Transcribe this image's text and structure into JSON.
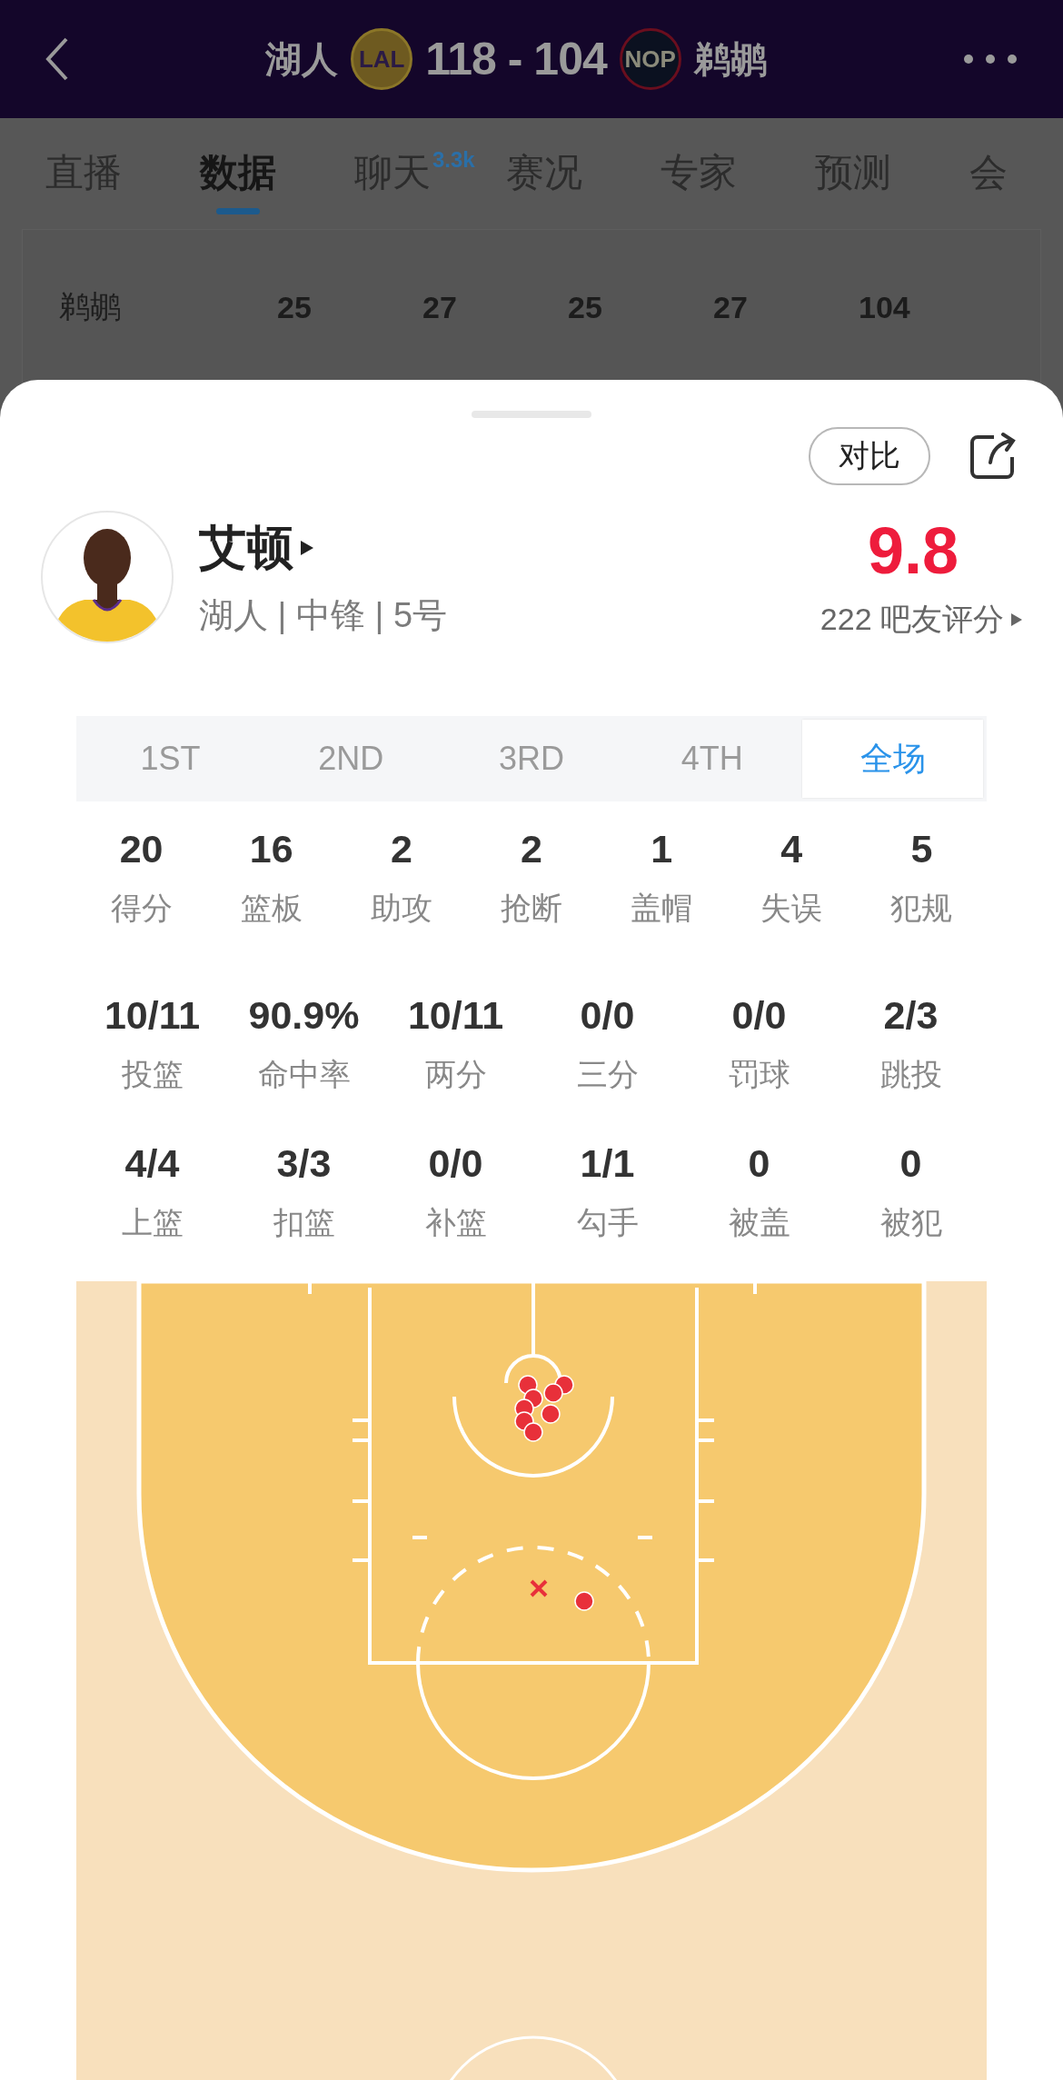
{
  "header": {
    "home_team": "湖人",
    "home_logo": "LAL",
    "score": "118 - 104",
    "away_logo": "NOP",
    "away_team": "鹈鹕"
  },
  "tabs": [
    {
      "label": "直播",
      "selected": false
    },
    {
      "label": "数据",
      "selected": true
    },
    {
      "label": "聊天",
      "selected": false,
      "badge": "3.3k"
    },
    {
      "label": "赛况",
      "selected": false
    },
    {
      "label": "专家",
      "selected": false
    },
    {
      "label": "预测",
      "selected": false
    },
    {
      "label": "会",
      "selected": false
    }
  ],
  "score_row": {
    "team": "鹈鹕",
    "values": [
      "25",
      "27",
      "25",
      "27",
      "104"
    ]
  },
  "sheet": {
    "compare_button": "对比",
    "player": {
      "name": "艾顿",
      "info": "湖人 | 中锋 | 5号",
      "rating": "9.8",
      "rating_count": "222 吧友评分"
    },
    "periods": [
      {
        "label": "1ST",
        "selected": false
      },
      {
        "label": "2ND",
        "selected": false
      },
      {
        "label": "3RD",
        "selected": false
      },
      {
        "label": "4TH",
        "selected": false
      },
      {
        "label": "全场",
        "selected": true
      }
    ],
    "stat_rows": [
      [
        {
          "value": "20",
          "label": "得分"
        },
        {
          "value": "16",
          "label": "篮板"
        },
        {
          "value": "2",
          "label": "助攻"
        },
        {
          "value": "2",
          "label": "抢断"
        },
        {
          "value": "1",
          "label": "盖帽"
        },
        {
          "value": "4",
          "label": "失误"
        },
        {
          "value": "5",
          "label": "犯规"
        }
      ],
      [
        {
          "value": "10/11",
          "label": "投篮"
        },
        {
          "value": "90.9%",
          "label": "命中率"
        },
        {
          "value": "10/11",
          "label": "两分"
        },
        {
          "value": "0/0",
          "label": "三分"
        },
        {
          "value": "0/0",
          "label": "罚球"
        },
        {
          "value": "2/3",
          "label": "跳投"
        }
      ],
      [
        {
          "value": "4/4",
          "label": "上篮"
        },
        {
          "value": "3/3",
          "label": "扣篮"
        },
        {
          "value": "0/0",
          "label": "补篮"
        },
        {
          "value": "1/1",
          "label": "勾手"
        },
        {
          "value": "0",
          "label": "被盖"
        },
        {
          "value": "0",
          "label": "被犯"
        }
      ]
    ]
  }
}
